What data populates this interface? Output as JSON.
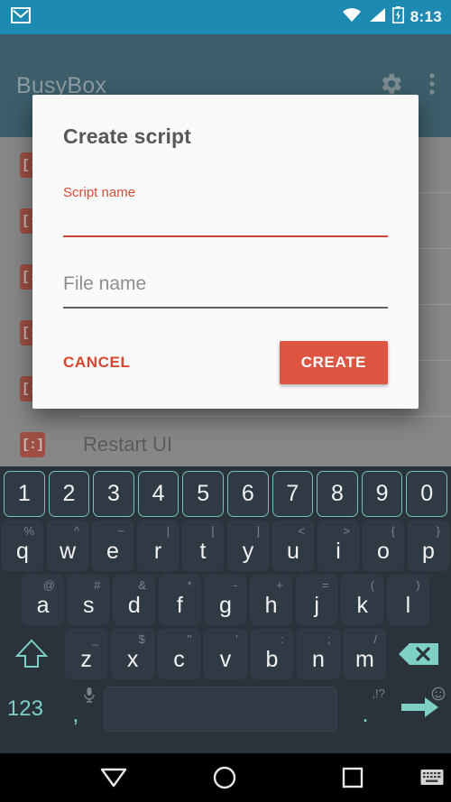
{
  "status_bar": {
    "time": "8:13",
    "icons": [
      "gmail-icon",
      "wifi-icon",
      "signal-icon",
      "battery-charging-icon"
    ],
    "background_color": "#1d8ab2"
  },
  "app_bar": {
    "title": "BusyBox",
    "settings_icon": "gear-icon",
    "overflow_icon": "overflow-menu-icon",
    "background_color": "#3c5e6b"
  },
  "background_list": {
    "rows": [
      {
        "icon": "script-brackets-icon",
        "label": ""
      },
      {
        "icon": "script-brackets-icon",
        "label": ""
      },
      {
        "icon": "script-brackets-icon",
        "label": ""
      },
      {
        "icon": "script-brackets-icon",
        "label": ""
      },
      {
        "icon": "script-brackets-icon",
        "label": ""
      },
      {
        "icon": "script-brackets-icon",
        "label": "Restart UI"
      }
    ],
    "icon_glyph": "[:]",
    "icon_color": "#9e4f44"
  },
  "dialog": {
    "title": "Create script",
    "script_name": {
      "label": "Script name",
      "value": "",
      "underline_color": "#cf4433",
      "focused": true
    },
    "file_name": {
      "placeholder": "File name",
      "value": "",
      "underline_color": "#636363",
      "focused": false
    },
    "cancel_label": "CANCEL",
    "create_label": "CREATE",
    "accent_color": "#dd5440"
  },
  "keyboard": {
    "accent_color": "#7ed0c4",
    "background_color": "#2a333c",
    "number_row": [
      "1",
      "2",
      "3",
      "4",
      "5",
      "6",
      "7",
      "8",
      "9",
      "0"
    ],
    "row1": [
      {
        "key": "q",
        "sub": "%"
      },
      {
        "key": "w",
        "sub": "^"
      },
      {
        "key": "e",
        "sub": "~"
      },
      {
        "key": "r",
        "sub": "|"
      },
      {
        "key": "t",
        "sub": "["
      },
      {
        "key": "y",
        "sub": "]"
      },
      {
        "key": "u",
        "sub": "<"
      },
      {
        "key": "i",
        "sub": ">"
      },
      {
        "key": "o",
        "sub": "{"
      },
      {
        "key": "p",
        "sub": "}"
      }
    ],
    "row2": [
      {
        "key": "a",
        "sub": "@"
      },
      {
        "key": "s",
        "sub": "#"
      },
      {
        "key": "d",
        "sub": "&"
      },
      {
        "key": "f",
        "sub": "*"
      },
      {
        "key": "g",
        "sub": "-"
      },
      {
        "key": "h",
        "sub": "+"
      },
      {
        "key": "j",
        "sub": "="
      },
      {
        "key": "k",
        "sub": "("
      },
      {
        "key": "l",
        "sub": ")"
      }
    ],
    "row3": [
      {
        "key": "z",
        "sub": "_"
      },
      {
        "key": "x",
        "sub": "$"
      },
      {
        "key": "c",
        "sub": "\""
      },
      {
        "key": "v",
        "sub": "'"
      },
      {
        "key": "b",
        "sub": ":"
      },
      {
        "key": "n",
        "sub": ";"
      },
      {
        "key": "m",
        "sub": "/"
      }
    ],
    "shift_icon": "shift-arrow-icon",
    "backspace_icon": "backspace-icon",
    "numeric_switch_label": "123",
    "comma_key": ",",
    "comma_sub_icon": "microphone-icon",
    "period_key": ".",
    "period_sub": ",!?",
    "enter_icon": "enter-arrow-icon",
    "enter_sub_icon": "emoji-smiley-icon",
    "space_key": " "
  },
  "nav_bar": {
    "back_icon": "back-triangle-icon",
    "home_icon": "home-circle-icon",
    "recents_icon": "recents-square-icon",
    "keyboard_icon": "keyboard-indicator-icon"
  }
}
